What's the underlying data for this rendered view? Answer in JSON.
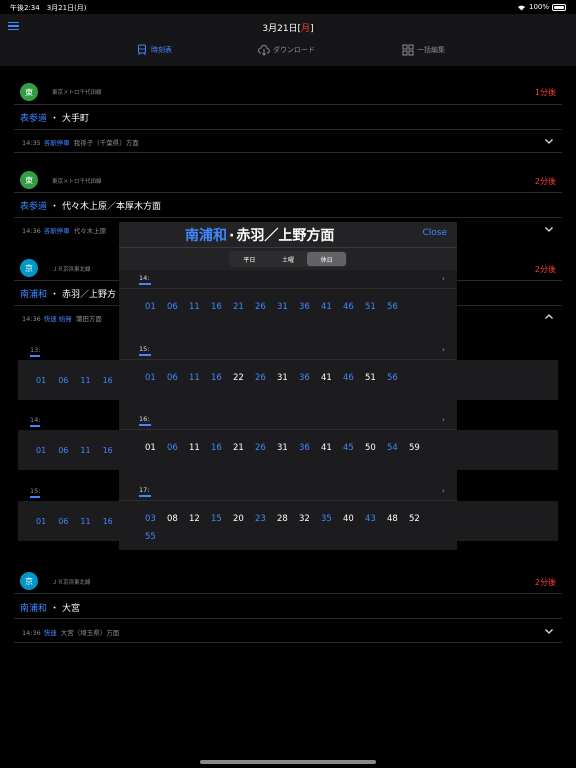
{
  "status_bar": {
    "time": "午後2:34　3月21日(月)",
    "battery": "100%"
  },
  "header": {
    "date_prefix": "3月21日[",
    "weekday": "月",
    "date_suffix": "]",
    "tabs": [
      {
        "label": "時刻表",
        "icon": "train-icon",
        "active": true
      },
      {
        "label": "ダウンロード",
        "icon": "cloud-download-icon",
        "active": false
      },
      {
        "label": "一括編集",
        "icon": "grid-icon",
        "active": false
      }
    ]
  },
  "departures": [
    {
      "badge": "東",
      "badge_color": "#2f9e44",
      "line": "東京メトロ千代田線",
      "remaining": "1分後",
      "from": "表参道",
      "to": "大手町",
      "time": "14:35",
      "service": "各駅停車",
      "destination": "我孫子（千葉県）方面"
    },
    {
      "badge": "東",
      "badge_color": "#2f9e44",
      "line": "東京メトロ千代田線",
      "remaining": "2分後",
      "from": "表参道",
      "to": "代々木上原／本厚木方面",
      "time": "14:36",
      "service": "各駅停車",
      "destination": "代々木上原"
    },
    {
      "badge": "京",
      "badge_color": "#0096c7",
      "line": "ＪＲ京浜東北線",
      "remaining": "2分後",
      "from": "南浦和",
      "to": "赤羽／上野方",
      "time": "14:36",
      "service": "快速 始発",
      "destination": "蒲田方面"
    },
    {
      "badge": "京",
      "badge_color": "#0096c7",
      "line": "ＪＲ京浜東北線",
      "remaining": "2分後",
      "from": "南浦和",
      "to": "大宮",
      "time": "14:36",
      "service": "快速",
      "destination": "大宮（埼玉県）方面"
    }
  ],
  "background_hours": [
    {
      "hour": "13:",
      "minutes": [
        "01",
        "06",
        "11",
        "16"
      ]
    },
    {
      "hour": "14:",
      "minutes": [
        "01",
        "06",
        "11",
        "16"
      ]
    },
    {
      "hour": "15:",
      "minutes": [
        "01",
        "06",
        "11",
        "16"
      ]
    }
  ],
  "modal": {
    "station": "南浦和",
    "separator": "·",
    "direction": "赤羽／上野方面",
    "close_label": "Close",
    "day_tabs": [
      {
        "label": "平日",
        "active": false
      },
      {
        "label": "土曜",
        "active": false
      },
      {
        "label": "休日",
        "active": true
      }
    ],
    "hours": [
      {
        "hour": "14:",
        "minutes": [
          {
            "m": "01",
            "rapid": true
          },
          {
            "m": "06",
            "rapid": true
          },
          {
            "m": "11",
            "rapid": true
          },
          {
            "m": "16",
            "rapid": true
          },
          {
            "m": "21",
            "rapid": true
          },
          {
            "m": "26",
            "rapid": true
          },
          {
            "m": "31",
            "rapid": true
          },
          {
            "m": "36",
            "rapid": true
          },
          {
            "m": "41",
            "rapid": true
          },
          {
            "m": "46",
            "rapid": true
          },
          {
            "m": "51",
            "rapid": true
          },
          {
            "m": "56",
            "rapid": true
          }
        ]
      },
      {
        "hour": "15:",
        "minutes": [
          {
            "m": "01",
            "rapid": true
          },
          {
            "m": "06",
            "rapid": true
          },
          {
            "m": "11",
            "rapid": true
          },
          {
            "m": "16",
            "rapid": true
          },
          {
            "m": "22",
            "rapid": false
          },
          {
            "m": "26",
            "rapid": true
          },
          {
            "m": "31",
            "rapid": false
          },
          {
            "m": "36",
            "rapid": true
          },
          {
            "m": "41",
            "rapid": false
          },
          {
            "m": "46",
            "rapid": true
          },
          {
            "m": "51",
            "rapid": false
          },
          {
            "m": "56",
            "rapid": true
          }
        ]
      },
      {
        "hour": "16:",
        "minutes": [
          {
            "m": "01",
            "rapid": false
          },
          {
            "m": "06",
            "rapid": true
          },
          {
            "m": "11",
            "rapid": false
          },
          {
            "m": "16",
            "rapid": true
          },
          {
            "m": "21",
            "rapid": false
          },
          {
            "m": "26",
            "rapid": true
          },
          {
            "m": "31",
            "rapid": false
          },
          {
            "m": "36",
            "rapid": true
          },
          {
            "m": "41",
            "rapid": false
          },
          {
            "m": "45",
            "rapid": true
          },
          {
            "m": "50",
            "rapid": false
          },
          {
            "m": "54",
            "rapid": true
          },
          {
            "m": "59",
            "rapid": false
          }
        ]
      },
      {
        "hour": "17:",
        "minutes": [
          {
            "m": "03",
            "rapid": true
          },
          {
            "m": "08",
            "rapid": false
          },
          {
            "m": "12",
            "rapid": false
          },
          {
            "m": "15",
            "rapid": true
          },
          {
            "m": "20",
            "rapid": false
          },
          {
            "m": "23",
            "rapid": true
          },
          {
            "m": "28",
            "rapid": false
          },
          {
            "m": "32",
            "rapid": false
          },
          {
            "m": "35",
            "rapid": true
          },
          {
            "m": "40",
            "rapid": false
          },
          {
            "m": "43",
            "rapid": true
          },
          {
            "m": "48",
            "rapid": false
          },
          {
            "m": "52",
            "rapid": false
          },
          {
            "m": "55",
            "rapid": true
          }
        ]
      }
    ]
  },
  "colors": {
    "accent": "#3f88ff",
    "alert": "#ff3b30"
  }
}
